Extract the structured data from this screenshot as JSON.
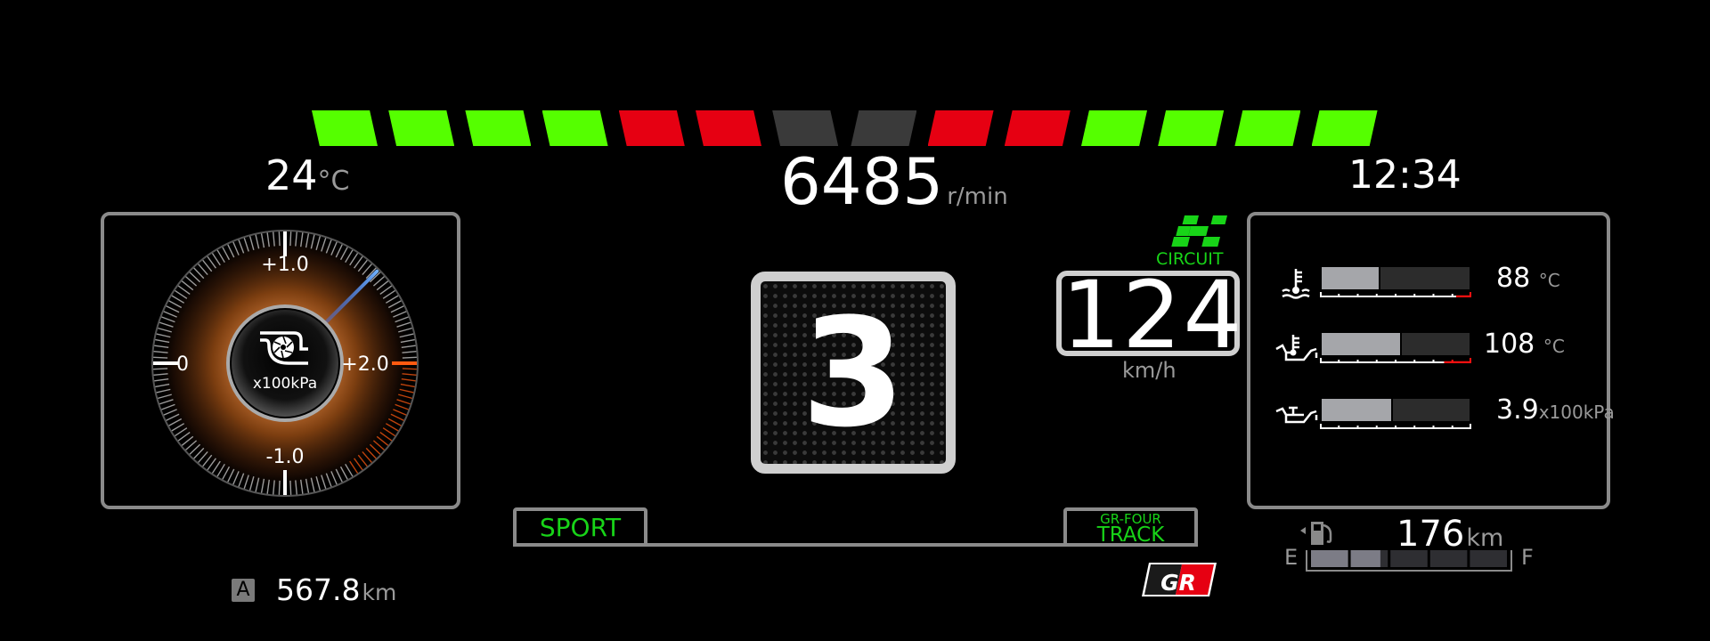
{
  "shift_lights": {
    "segments": [
      {
        "side": "left",
        "state": "on",
        "color": "#55ff00"
      },
      {
        "side": "left",
        "state": "on",
        "color": "#55ff00"
      },
      {
        "side": "left",
        "state": "on",
        "color": "#55ff00"
      },
      {
        "side": "left",
        "state": "on",
        "color": "#55ff00"
      },
      {
        "side": "left",
        "state": "on",
        "color": "#e60012"
      },
      {
        "side": "left",
        "state": "on",
        "color": "#e60012"
      },
      {
        "side": "left",
        "state": "off",
        "color": "#3a3a3a"
      },
      {
        "side": "right",
        "state": "off",
        "color": "#3a3a3a"
      },
      {
        "side": "right",
        "state": "on",
        "color": "#e60012"
      },
      {
        "side": "right",
        "state": "on",
        "color": "#e60012"
      },
      {
        "side": "right",
        "state": "on",
        "color": "#55ff00"
      },
      {
        "side": "right",
        "state": "on",
        "color": "#55ff00"
      },
      {
        "side": "right",
        "state": "on",
        "color": "#55ff00"
      },
      {
        "side": "right",
        "state": "on",
        "color": "#55ff00"
      }
    ]
  },
  "outside_temp": {
    "value": "24",
    "unit": "°C"
  },
  "tachometer": {
    "value": "6485",
    "unit": "r/min"
  },
  "clock": {
    "time": "12:34"
  },
  "boost_gauge": {
    "icon": "turbo-icon",
    "unit": "x100kPa",
    "labels": {
      "top": "+1.0",
      "left": "0",
      "right": "+2.0",
      "bottom": "-1.0"
    },
    "needle_value": 1.5,
    "scale_min": -1.0,
    "scale_max": 2.0,
    "needle_color": "#3a8dff",
    "glow_color": "#b8601e",
    "redzone_color": "#ff5a10"
  },
  "gear": {
    "value": "3"
  },
  "drive_mode": {
    "icon": "checkered-flag-icon",
    "label": "CIRCUIT",
    "color": "#18d418"
  },
  "speed": {
    "value": "124",
    "unit": "km/h"
  },
  "fluids": [
    {
      "name": "coolant-temp",
      "icon": "coolant-temp-icon",
      "value": "88",
      "unit": "°C",
      "fill_fraction": 0.4,
      "red_zone_start": 0.9
    },
    {
      "name": "oil-temp",
      "icon": "oil-temp-icon",
      "value": "108",
      "unit": "°C",
      "fill_fraction": 0.54,
      "red_zone_start": 0.82
    },
    {
      "name": "oil-pressure",
      "icon": "oil-pressure-icon",
      "value": "3.9",
      "unit": "x100kPa",
      "fill_fraction": 0.48,
      "red_zone_start": null
    }
  ],
  "modes": {
    "sport": "SPORT",
    "gr_four_top": "GR-FOUR",
    "gr_four_bottom": "TRACK",
    "mode_color": "#18d418"
  },
  "odometer": {
    "trip_label": "A",
    "value": "567.8",
    "unit": "km"
  },
  "fuel": {
    "range": "176",
    "unit": "km",
    "empty_label": "E",
    "full_label": "F",
    "total_segments": 5,
    "level_fraction": 0.36
  },
  "logo": {
    "text": "GR",
    "colors": [
      "#1a1a1a",
      "#e60012"
    ]
  }
}
